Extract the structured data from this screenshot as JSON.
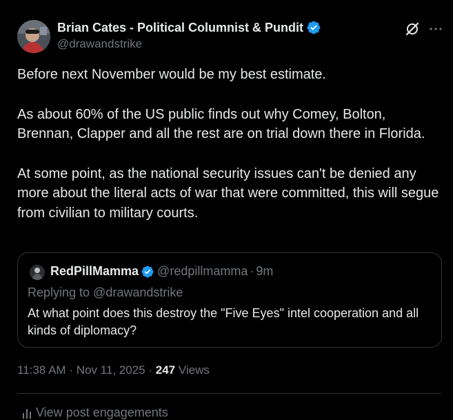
{
  "author": {
    "name": "Brian Cates - Political Columnist & Pundit",
    "handle": "@drawandstrike",
    "verified": true
  },
  "body": {
    "paragraph_1": "Before next November would be my best estimate.",
    "paragraph_2": "As about 60% of the US public finds out why Comey, Bolton, Brennan, Clapper and all the rest are on trial down there in Florida.",
    "paragraph_3": "At some point, as the national security issues can't be denied any more about the literal acts of war that were committed, this will segue from civilian to military courts."
  },
  "quoted": {
    "name": "RedPillMamma",
    "handle": "@redpillmamma",
    "separator": "·",
    "time": "9m",
    "replying_to": "Replying to @drawandstrike",
    "text": "At what point does this destroy the \"Five Eyes\" intel cooperation and all kinds of diplomacy?",
    "verified": true
  },
  "meta": {
    "time": "11:38 AM",
    "separator": "·",
    "date": "Nov 11, 2025",
    "views_count": "247",
    "views_label": "Views"
  },
  "engagements": {
    "label": "View post engagements"
  },
  "icons": {
    "grok": "grok-icon",
    "more": "more-icon",
    "verified": "verified-badge-icon",
    "engagements": "bar-chart-icon"
  },
  "colors": {
    "background": "#000000",
    "text": "#e7e9ea",
    "secondary": "#71767b",
    "verified": "#1d9bf0",
    "border": "#2f3336"
  }
}
